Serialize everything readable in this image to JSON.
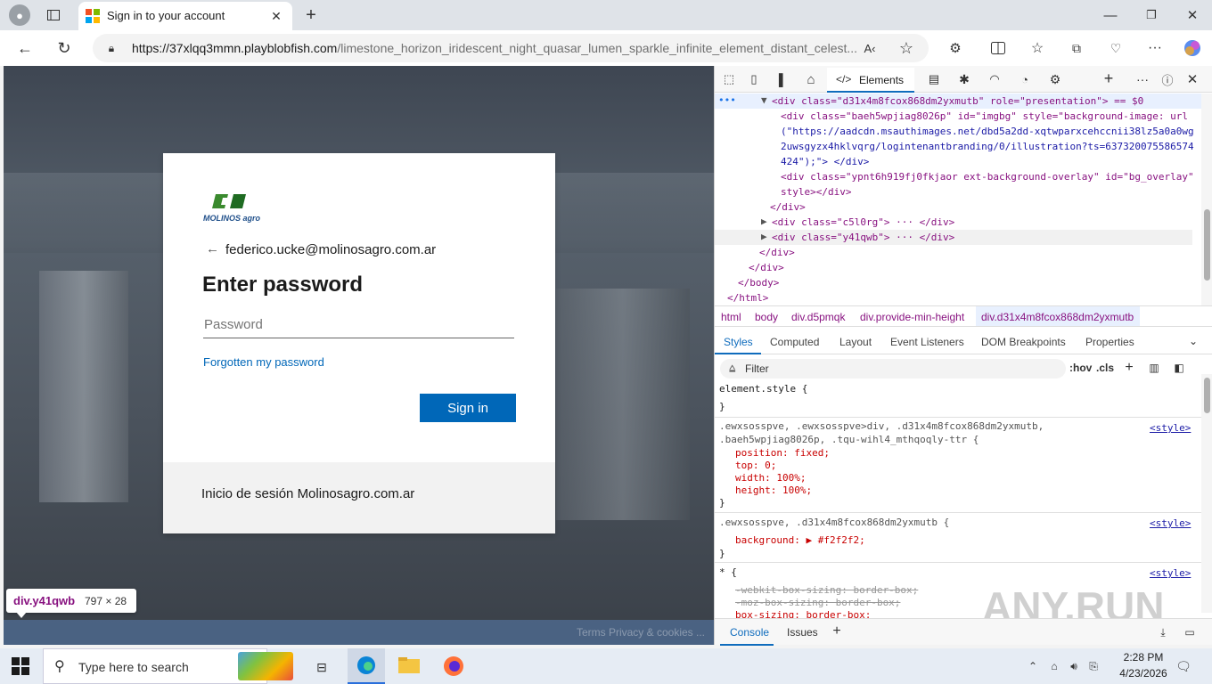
{
  "browser": {
    "tab_title": "Sign in to your account",
    "url_host": "https://37xlqq3mmn.playblobfish.com",
    "url_path": "/limestone_horizon_iridescent_night_quasar_lumen_sparkle_infinite_element_distant_celest..."
  },
  "login": {
    "logo_text": "MOLINOS agro",
    "email": "federico.ucke@molinosagro.com.ar",
    "heading": "Enter password",
    "password_placeholder": "Password",
    "forgot_link": "Forgotten my password",
    "signin_button": "Sign in",
    "footer_text": "Inicio de sesión Molinosagro.com.ar",
    "bottom_links": "Terms   Privacy & cookies   ..."
  },
  "inspector_tooltip": {
    "name": "div.y41qwb",
    "size": "797 × 28"
  },
  "devtools": {
    "tabs": [
      "Elements"
    ],
    "dom_lines": [
      "<div class=\"d31x4m8fcox868dm2yxmutb\" role=\"presentation\"> == $0",
      "<div class=\"baeh5wpjiag8026p\" id=\"imgbg\" style=\"background-image: url",
      "(\"https://aadcdn.msauthimages.net/dbd5a2dd-xqtwparxcehccnii38lz5a0a0wg",
      "2uwsgyzx4hklvqrg/logintenantbranding/0/illustration?ts=637320075586574",
      "424\");\"> </div>",
      "<div class=\"ypnt6h919fj0fkjaor ext-background-overlay\" id=\"bg_overlay\"",
      "style></div>",
      "</div>",
      "<div class=\"c5l0rg\"> ··· </div>",
      "<div class=\"y41qwb\"> ··· </div>",
      "</div>",
      "</div>",
      "</body>",
      "</html>"
    ],
    "breadcrumbs": [
      "html",
      "body",
      "div.d5pmqk",
      "div.provide-min-height",
      "div.d31x4m8fcox868dm2yxmutb"
    ],
    "style_tabs": [
      "Styles",
      "Computed",
      "Layout",
      "Event Listeners",
      "DOM Breakpoints",
      "Properties"
    ],
    "filter_placeholder": "Filter",
    "hov": ":hov",
    "cls": ".cls",
    "rules": [
      {
        "selector": "element.style {",
        "props": [],
        "close": "}",
        "source": ""
      },
      {
        "selector": ".ewxsosspve, .ewxsosspve>div, .d31x4m8fcox868dm2yxmutb,",
        "selector2": ".baeh5wpjiag8026p, .tqu-wihl4_mthqoqly-ttr {",
        "props": [
          "position: fixed;",
          "top: 0;",
          "width: 100%;",
          "height: 100%;"
        ],
        "close": "}",
        "source": "<style>"
      },
      {
        "selector": ".ewxsosspve, .d31x4m8fcox868dm2yxmutb {",
        "props": [
          "background: ▶ #f2f2f2;"
        ],
        "close": "}",
        "source": "<style>"
      },
      {
        "selector": "* {",
        "props": [
          "-webkit-box-sizing: border-box;",
          "-moz-box-sizing: border-box;",
          "box-sizing: border-box;"
        ],
        "close": "",
        "source": "<style>"
      }
    ],
    "drawer_tabs": [
      "Console",
      "Issues"
    ]
  },
  "taskbar": {
    "search_placeholder": "Type here to search",
    "time": "2:28 PM",
    "date": "4/23/2026"
  },
  "watermark": "ANY.RUN"
}
